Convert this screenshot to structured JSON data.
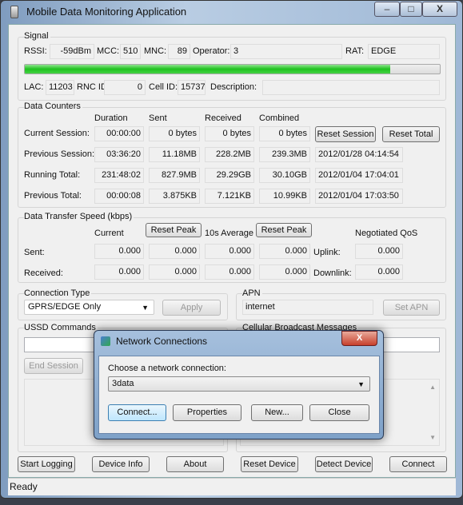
{
  "window": {
    "title": "Mobile Data Monitoring Application",
    "minimize": "–",
    "maximize": "□",
    "close": "X"
  },
  "signal": {
    "label": "Signal",
    "rssi_label": "RSSI:",
    "rssi": "-59dBm",
    "mcc_label": "MCC:",
    "mcc": "510",
    "mnc_label": "MNC:",
    "mnc": "89",
    "operator_label": "Operator:",
    "operator": "3",
    "rat_label": "RAT:",
    "rat": "EDGE",
    "strength_percent": 88,
    "bar_color": "#1fc21f",
    "lac_label": "LAC:",
    "lac": "11203",
    "rnc_label": "RNC ID:",
    "rnc": "0",
    "cell_label": "Cell ID:",
    "cell": "15737",
    "desc_label": "Description:",
    "desc": ""
  },
  "counters": {
    "label": "Data Counters",
    "headers": [
      "Duration",
      "Sent",
      "Received",
      "Combined"
    ],
    "rows": [
      {
        "label": "Current Session:",
        "values": [
          "00:00:00",
          "0 bytes",
          "0 bytes",
          "0 bytes"
        ],
        "date": ""
      },
      {
        "label": "Previous Session:",
        "values": [
          "03:36:20",
          "11.18MB",
          "228.2MB",
          "239.3MB"
        ],
        "date": "2012/01/28 04:14:54"
      },
      {
        "label": "Running Total:",
        "values": [
          "231:48:02",
          "827.9MB",
          "29.29GB",
          "30.10GB"
        ],
        "date": "2012/01/04 17:04:01"
      },
      {
        "label": "Previous Total:",
        "values": [
          "00:00:08",
          "3.875KB",
          "7.121KB",
          "10.99KB"
        ],
        "date": "2012/01/04 17:03:50"
      }
    ],
    "reset_session": "Reset Session",
    "reset_total": "Reset Total"
  },
  "speed": {
    "label": "Data Transfer Speed (kbps)",
    "current": "Current",
    "reset_peak1": "Reset Peak",
    "avg": "10s Average",
    "reset_peak2": "Reset Peak",
    "qos": "Negotiated QoS",
    "rows": [
      {
        "label": "Sent:",
        "values": [
          "0.000",
          "0.000",
          "0.000",
          "0.000"
        ],
        "qos_label": "Uplink:",
        "qos": "0.000"
      },
      {
        "label": "Received:",
        "values": [
          "0.000",
          "0.000",
          "0.000",
          "0.000"
        ],
        "qos_label": "Downlink:",
        "qos": "0.000"
      }
    ]
  },
  "conn": {
    "label": "Connection Type",
    "value": "GPRS/EDGE Only",
    "apply": "Apply"
  },
  "apn": {
    "label": "APN",
    "value": "internet",
    "set": "Set APN"
  },
  "ussd": {
    "label": "USSD Commands",
    "end": "End Session"
  },
  "cbm": {
    "label": "Cellular Broadcast Messages"
  },
  "buttons": [
    "Start Logging",
    "Device Info",
    "About",
    "Reset Device",
    "Detect Device",
    "Connect"
  ],
  "status": "Ready",
  "dialog": {
    "title": "Network Connections",
    "close": "X",
    "prompt": "Choose a network connection:",
    "selected": "3data",
    "buttons": [
      "Connect...",
      "Properties",
      "New...",
      "Close"
    ]
  }
}
